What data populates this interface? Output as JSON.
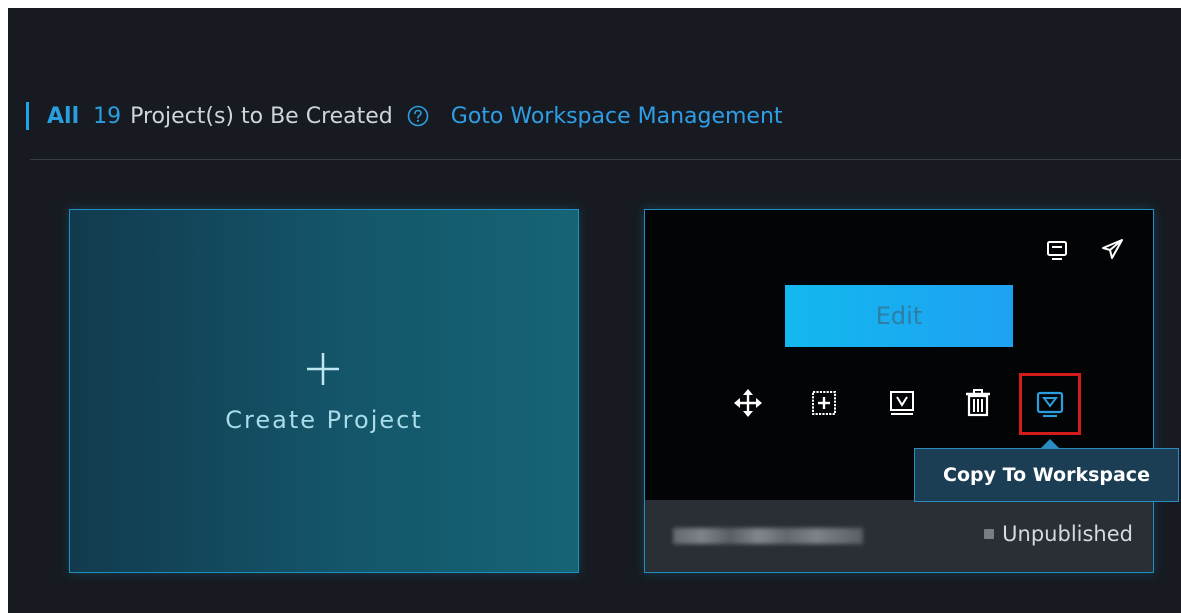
{
  "header": {
    "all_label": "All",
    "count": "19",
    "text": "Project(s) to Be Created",
    "help_icon": "question-circle-icon",
    "goto_link": "Goto Workspace Management"
  },
  "create_card": {
    "icon": "plus-icon",
    "label": "Create Project"
  },
  "project_card": {
    "top_icons": [
      "screen-icon",
      "send-icon"
    ],
    "edit_label": "Edit",
    "actions": [
      "move-icon",
      "add-icon",
      "preview-icon",
      "delete-icon",
      "copy-to-workspace-icon"
    ],
    "status_label": "Unpublished"
  },
  "tooltip": {
    "text": "Copy To Workspace"
  },
  "colors": {
    "background": "#171b21",
    "accent": "#1ea7e6",
    "link": "#2f9ee6",
    "highlight": "#d41c1c",
    "edit_button": "#12b8ee"
  }
}
